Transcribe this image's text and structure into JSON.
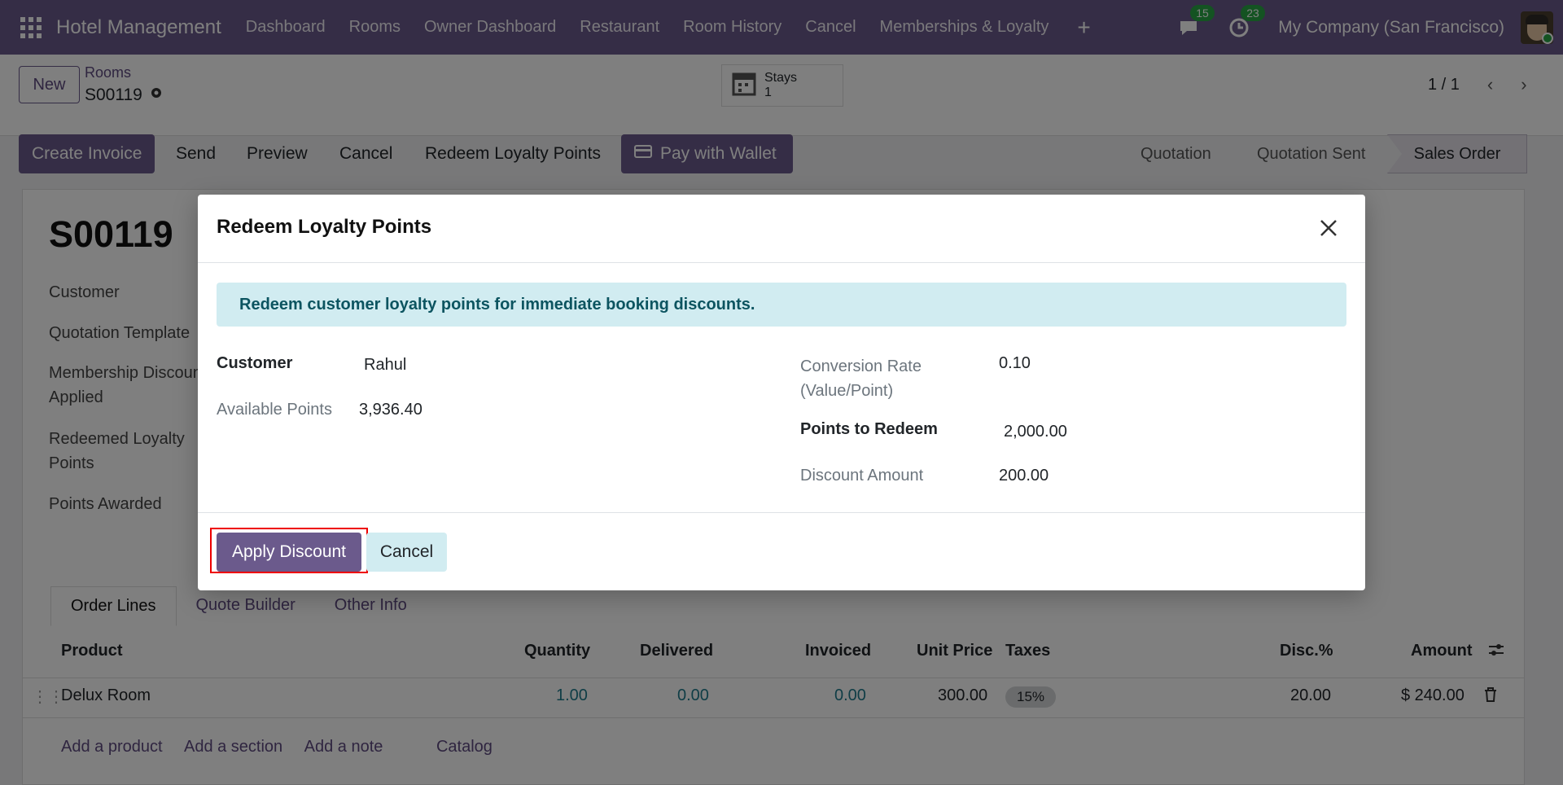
{
  "navbar": {
    "brand": "Hotel Management",
    "items": [
      "Dashboard",
      "Rooms",
      "Owner Dashboard",
      "Restaurant",
      "Room History",
      "Cancel",
      "Memberships & Loyalty"
    ],
    "messages_count": "15",
    "activities_count": "23",
    "company": "My Company (San Francisco)"
  },
  "control": {
    "new_label": "New",
    "breadcrumb_parent": "Rooms",
    "breadcrumb_current": "S00119",
    "stays_label": "Stays",
    "stays_count": "1",
    "pager": "1 / 1"
  },
  "actions": {
    "create_invoice": "Create Invoice",
    "send": "Send",
    "preview": "Preview",
    "cancel": "Cancel",
    "redeem": "Redeem Loyalty Points",
    "pay_wallet": "Pay with Wallet",
    "status_quotation": "Quotation",
    "status_sent": "Quotation Sent",
    "status_order": "Sales Order"
  },
  "form": {
    "title": "S00119",
    "labels": {
      "customer": "Customer",
      "quotation_template": "Quotation Template",
      "membership_discount_1": "Membership Discount",
      "membership_discount_2": "Applied",
      "redeemed_points_1": "Redeemed Loyalty",
      "redeemed_points_2": "Points",
      "points_awarded": "Points Awarded"
    },
    "tabs": [
      "Order Lines",
      "Quote Builder",
      "Other Info"
    ],
    "table": {
      "headers": [
        "Product",
        "Quantity",
        "Delivered",
        "Invoiced",
        "Unit Price",
        "Taxes",
        "Disc.%",
        "Amount"
      ],
      "rows": [
        {
          "product": "Delux Room",
          "quantity": "1.00",
          "delivered": "0.00",
          "invoiced": "0.00",
          "unit_price": "300.00",
          "taxes": "15%",
          "disc": "20.00",
          "amount": "$ 240.00"
        }
      ]
    },
    "add_links": [
      "Add a product",
      "Add a section",
      "Add a note",
      "Catalog"
    ]
  },
  "modal": {
    "title": "Redeem Loyalty Points",
    "alert": "Redeem customer loyalty points for immediate booking discounts.",
    "customer_label": "Customer",
    "customer_value": "Rahul",
    "available_label": "Available Points",
    "available_value": "3,936.40",
    "rate_label_1": "Conversion Rate",
    "rate_label_2": "(Value/Point)",
    "rate_value": "0.10",
    "points_label": "Points to Redeem",
    "points_value": "2,000.00",
    "discount_label": "Discount Amount",
    "discount_value": "200.00",
    "apply_label": "Apply Discount",
    "cancel_label": "Cancel"
  },
  "colors": {
    "brand": "#6b5a8c",
    "alert_bg": "#d1ecf1",
    "highlight": "#ee0000"
  }
}
